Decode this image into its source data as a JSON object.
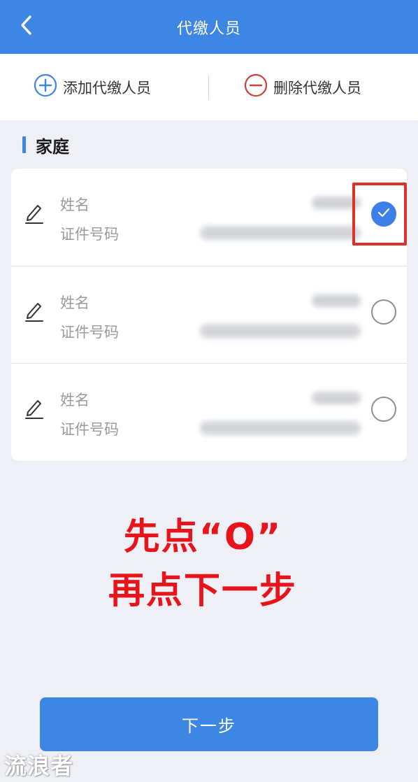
{
  "header": {
    "title": "代缴人员",
    "back_icon": "chevron-left-icon",
    "background": "#3e86e3"
  },
  "actions": {
    "add_label": "添加代缴人员",
    "add_icon": "plus-circle-icon",
    "remove_label": "删除代缴人员",
    "remove_icon": "minus-circle-icon",
    "add_color": "#3e86e3",
    "remove_color": "#c9433a"
  },
  "section": {
    "title": "家庭"
  },
  "persons": [
    {
      "name_label": "姓名",
      "id_label": "证件号码",
      "selected": true
    },
    {
      "name_label": "姓名",
      "id_label": "证件号码",
      "selected": false
    },
    {
      "name_label": "姓名",
      "id_label": "证件号码",
      "selected": false
    }
  ],
  "annotation": {
    "line1": "先点“O”",
    "line2": "再点下一步",
    "color": "#e8141c"
  },
  "next_button": {
    "label": "下一步"
  },
  "watermark": {
    "text": "流浪者"
  }
}
